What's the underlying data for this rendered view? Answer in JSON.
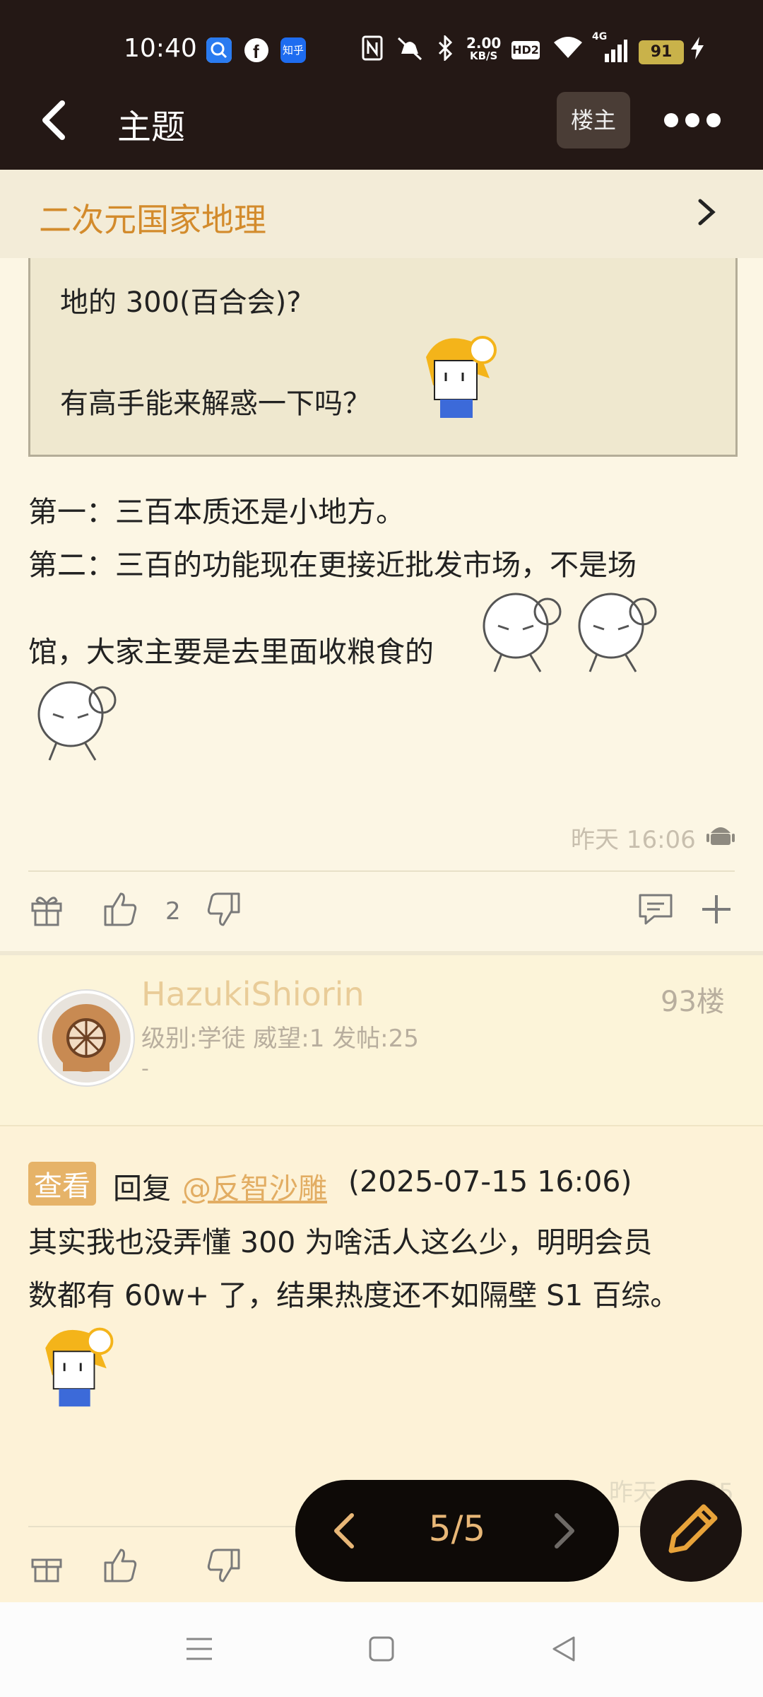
{
  "status_bar": {
    "time": "10:40",
    "net_speed_value": "2.00",
    "net_speed_unit": "KB/S",
    "hd_label": "HD2",
    "signal": "4G",
    "battery": "91",
    "app_icons": [
      "search-app-icon",
      "facebook-icon",
      "zhihu-icon"
    ],
    "zhihu_label": "知乎"
  },
  "title_bar": {
    "title": "主题",
    "louzhu_label": "楼主"
  },
  "forum": {
    "name": "二次元国家地理"
  },
  "post1": {
    "quote_lines": [
      "地的 300(百合会)?",
      "有高手能来解惑一下吗？"
    ],
    "body_lines": [
      "第一：三百本质还是小地方。",
      "第二：三百的功能现在更接近批发市场，不是场",
      "馆，大家主要是去里面收粮食的"
    ],
    "time": "昨天 16:06",
    "like_count": "2"
  },
  "post2_user": {
    "username": "HazukiShiorin",
    "floor": "93楼",
    "info": "级别:学徒 威望:1 发帖:25",
    "signature": "-"
  },
  "post2": {
    "view_badge": "查看",
    "reply_prefix": "回复",
    "mention": "@反智沙雕",
    "reply_date": "(2025-07-15 16:06)",
    "body_lines": [
      "其实我也没弄懂 300 为啥活人这么少，明明会员",
      "数都有 60w+ 了，结果热度还不如隔壁 S1 百综。"
    ],
    "time_faded": "昨天 17:25"
  },
  "pager": {
    "label": "5/5"
  },
  "colors": {
    "topbar": "#241815",
    "accent": "#d38b2c",
    "background": "#fbf6e6"
  }
}
